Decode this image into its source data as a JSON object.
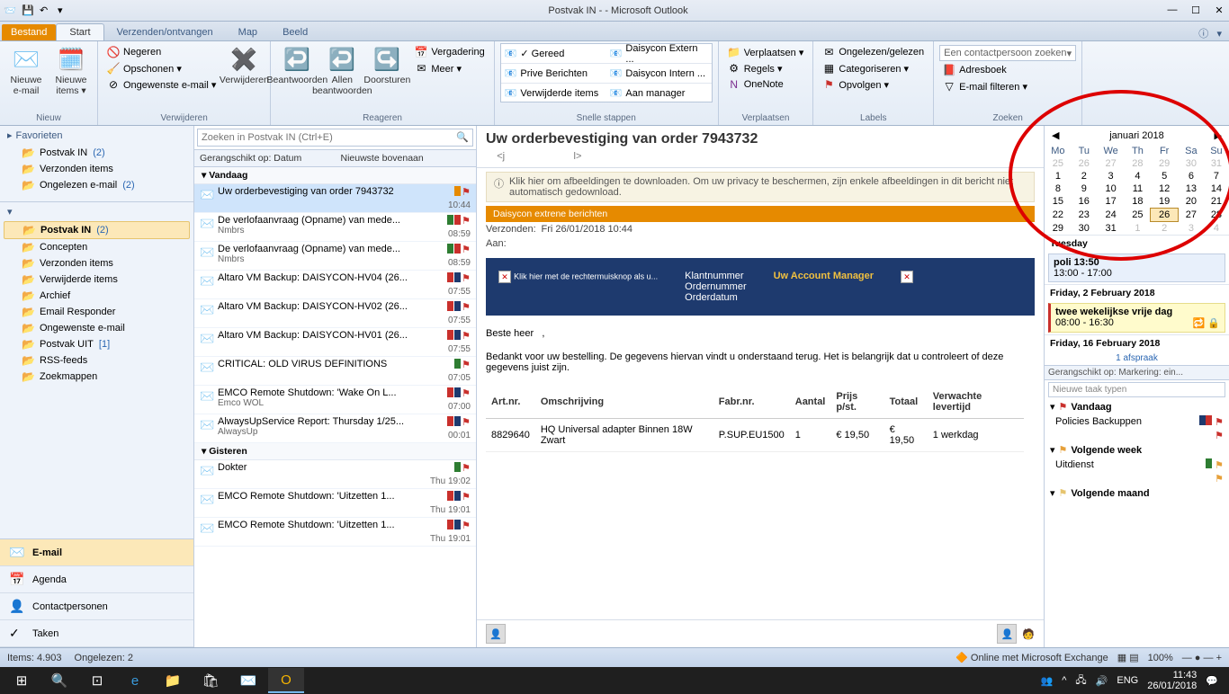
{
  "titlebar": {
    "title": "Postvak IN -                         - Microsoft Outlook"
  },
  "tabs": {
    "file": "Bestand",
    "home": "Start",
    "sendrecv": "Verzenden/ontvangen",
    "folder": "Map",
    "view": "Beeld"
  },
  "ribbon": {
    "new": {
      "label": "Nieuw",
      "newemail": "Nieuwe\ne-mail",
      "newitems": "Nieuwe\nitems ▾"
    },
    "delete": {
      "label": "Verwijderen",
      "ignore": "Negeren",
      "cleanup": "Opschonen ▾",
      "junk": "Ongewenste e-mail ▾",
      "delete_btn": "Verwijderen"
    },
    "respond": {
      "label": "Reageren",
      "reply": "Beantwoorden",
      "replyall": "Allen\nbeantwoorden",
      "forward": "Doorsturen",
      "meeting": "Vergadering",
      "more": "Meer ▾"
    },
    "quicksteps": {
      "label": "Snelle stappen",
      "items": [
        "✓ Gereed",
        "Daisycon Extern ...",
        "Prive Berichten",
        "Daisycon Intern ...",
        "Verwijderde items",
        "Aan manager"
      ]
    },
    "move": {
      "label": "Verplaatsen",
      "move_btn": "Verplaatsen ▾",
      "rules": "Regels ▾",
      "onenote": "OneNote"
    },
    "tags": {
      "label": "Labels",
      "unread": "Ongelezen/gelezen",
      "categorize": "Categoriseren ▾",
      "followup": "Opvolgen ▾"
    },
    "find": {
      "label": "Zoeken",
      "findcontact": "Een contactpersoon zoeken",
      "addressbook": "Adresboek",
      "filter": "E-mail filteren ▾"
    }
  },
  "nav": {
    "favorites": "Favorieten",
    "fav_items": [
      {
        "label": "Postvak IN",
        "count": "(2)"
      },
      {
        "label": "Verzonden items"
      },
      {
        "label": "Ongelezen e-mail",
        "count": "(2)"
      }
    ],
    "mailbox_items": [
      {
        "label": "Postvak IN",
        "count": "(2)",
        "sel": true
      },
      {
        "label": "Concepten"
      },
      {
        "label": "Verzonden items"
      },
      {
        "label": "Verwijderde items"
      },
      {
        "label": "Archief"
      },
      {
        "label": "Email Responder"
      },
      {
        "label": "Ongewenste e-mail"
      },
      {
        "label": "Postvak UIT",
        "count": "[1]"
      },
      {
        "label": "RSS-feeds"
      },
      {
        "label": "Zoekmappen"
      }
    ],
    "bottom": {
      "mail": "E-mail",
      "calendar": "Agenda",
      "contacts": "Contactpersonen",
      "tasks": "Taken"
    }
  },
  "msglist": {
    "search_ph": "Zoeken in Postvak IN (Ctrl+E)",
    "sort_by": "Gerangschikt op: Datum",
    "sort_order": "Nieuwste bovenaan",
    "group_today": "Vandaag",
    "group_yesterday": "Gisteren",
    "items": [
      {
        "subj": "Uw orderbevestiging van order 7943732",
        "from": "",
        "time": "10:44",
        "sel": true,
        "cats": [
          "#e68a00"
        ]
      },
      {
        "subj": "De verlofaanvraag (Opname) van mede...",
        "from": "Nmbrs",
        "time": "08:59",
        "cats": [
          "#2e7d32",
          "#c9302c"
        ]
      },
      {
        "subj": "De verlofaanvraag (Opname) van mede...",
        "from": "Nmbrs",
        "time": "08:59",
        "cats": [
          "#2e7d32",
          "#c9302c"
        ]
      },
      {
        "subj": "Altaro VM Backup: DAISYCON-HV04 (26...",
        "from": "",
        "time": "07:55",
        "cats": [
          "#c9302c",
          "#1e3a6e"
        ]
      },
      {
        "subj": "Altaro VM Backup: DAISYCON-HV02 (26...",
        "from": "",
        "time": "07:55",
        "cats": [
          "#c9302c",
          "#1e3a6e"
        ]
      },
      {
        "subj": "Altaro VM Backup: DAISYCON-HV01 (26...",
        "from": "",
        "time": "07:55",
        "cats": [
          "#c9302c",
          "#1e3a6e"
        ]
      },
      {
        "subj": "CRITICAL: OLD VIRUS DEFINITIONS",
        "from": "",
        "time": "07:05",
        "cats": [
          "#2e7d32"
        ]
      },
      {
        "subj": "EMCO Remote Shutdown: 'Wake On L...",
        "from": "Emco WOL",
        "time": "07:00",
        "cats": [
          "#c9302c",
          "#1e3a6e"
        ]
      },
      {
        "subj": "AlwaysUpService Report: Thursday 1/25...",
        "from": "AlwaysUp",
        "time": "00:01",
        "cats": [
          "#c9302c",
          "#1e3a6e"
        ]
      }
    ],
    "items_y": [
      {
        "subj": "Dokter",
        "from": "",
        "time": "Thu 19:02",
        "cats": [
          "#2e7d32"
        ]
      },
      {
        "subj": "EMCO Remote Shutdown: 'Uitzetten 1...",
        "from": "",
        "time": "Thu 19:01",
        "cats": [
          "#c9302c",
          "#1e3a6e"
        ]
      },
      {
        "subj": "EMCO Remote Shutdown: 'Uitzetten 1...",
        "from": "",
        "time": "Thu 19:01",
        "cats": [
          "#c9302c",
          "#1e3a6e"
        ]
      }
    ]
  },
  "reading": {
    "subject": "Uw orderbevestiging van order 7943732",
    "download_note": "Klik hier om afbeeldingen te downloaden. Om uw privacy te beschermen, zijn enkele afbeeldingen in dit bericht niet automatisch gedownload.",
    "daisy": "Daisycon extrene berichten",
    "sent_lbl": "Verzonden:",
    "sent_val": "Fri 26/01/2018 10:44",
    "to_lbl": "Aan:",
    "hdr_klant": "Klantnummer",
    "hdr_order": "Ordernummer",
    "hdr_datum": "Orderdatum",
    "hdr_manager": "Uw Account Manager",
    "img_alt": "Klik hier met de rechtermuisknop als u...",
    "greeting": "Beste heer",
    "intro": "Bedankt voor uw bestelling. De gegevens hiervan vindt u onderstaand terug. Het is belangrijk dat u controleert of deze gegevens juist zijn.",
    "th": [
      "Art.nr.",
      "Omschrijving",
      "Fabr.nr.",
      "Aantal",
      "Prijs p/st.",
      "Totaal",
      "Verwachte levertijd"
    ],
    "row": [
      "8829640",
      "HQ Universal adapter Binnen 18W Zwart",
      "P.SUP.EU1500",
      "1",
      "€ 19,50",
      "€ 19,50",
      "1 werkdag"
    ]
  },
  "todo": {
    "month": "januari 2018",
    "dow": [
      "Mo",
      "Tu",
      "We",
      "Th",
      "Fr",
      "Sa",
      "Su"
    ],
    "weeks": [
      [
        {
          "d": 25,
          "o": 1
        },
        {
          "d": 26,
          "o": 1
        },
        {
          "d": 27,
          "o": 1
        },
        {
          "d": 28,
          "o": 1
        },
        {
          "d": 29,
          "o": 1
        },
        {
          "d": 30,
          "o": 1
        },
        {
          "d": 31,
          "o": 1
        }
      ],
      [
        {
          "d": 1
        },
        {
          "d": 2
        },
        {
          "d": 3
        },
        {
          "d": 4
        },
        {
          "d": 5
        },
        {
          "d": 6
        },
        {
          "d": 7
        }
      ],
      [
        {
          "d": 8
        },
        {
          "d": 9
        },
        {
          "d": 10
        },
        {
          "d": 11
        },
        {
          "d": 12
        },
        {
          "d": 13
        },
        {
          "d": 14
        }
      ],
      [
        {
          "d": 15
        },
        {
          "d": 16
        },
        {
          "d": 17
        },
        {
          "d": 18
        },
        {
          "d": 19
        },
        {
          "d": 20
        },
        {
          "d": 21
        }
      ],
      [
        {
          "d": 22
        },
        {
          "d": 23
        },
        {
          "d": 24
        },
        {
          "d": 25
        },
        {
          "d": 26,
          "t": 1
        },
        {
          "d": 27
        },
        {
          "d": 28
        }
      ],
      [
        {
          "d": 29
        },
        {
          "d": 30
        },
        {
          "d": 31
        },
        {
          "d": 1,
          "o": 1
        },
        {
          "d": 2,
          "o": 1
        },
        {
          "d": 3,
          "o": 1
        },
        {
          "d": 4,
          "o": 1
        }
      ]
    ],
    "day_hdr": "Tuesday",
    "appt1_title": "poli 13:50",
    "appt1_time": "13:00 - 17:00",
    "day2": "Friday, 2 February 2018",
    "appt2_title": "twee wekelijkse vrije dag",
    "appt2_time": "08:00 - 16:30",
    "day3": "Friday, 16 February 2018",
    "appt3_sub": "1 afspraak",
    "task_sort": "Gerangschikt op: Markering: ein...",
    "task_ph": "Nieuwe taak typen",
    "grp_today": "Vandaag",
    "task1": "Policies Backuppen",
    "grp_next": "Volgende week",
    "task2": "Uitdienst",
    "grp_month": "Volgende maand"
  },
  "status": {
    "items": "Items: 4.903",
    "unread": "Ongelezen: 2",
    "online": "Online met Microsoft Exchange",
    "zoom": "100%"
  },
  "tray": {
    "lang": "ENG",
    "time": "11:43",
    "date": "26/01/2018"
  }
}
